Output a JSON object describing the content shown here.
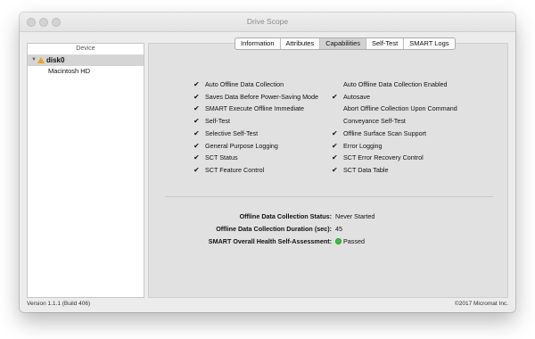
{
  "window": {
    "title": "Drive Scope"
  },
  "sidebar": {
    "header": "Device",
    "disk": {
      "label": "disk0",
      "icon": "warning-icon"
    },
    "volumes": [
      "Macintosh HD"
    ]
  },
  "tabs": [
    {
      "label": "Information",
      "active": false
    },
    {
      "label": "Attributes",
      "active": false
    },
    {
      "label": "Capabilities",
      "active": true
    },
    {
      "label": "Self-Test",
      "active": false
    },
    {
      "label": "SMART Logs",
      "active": false
    }
  ],
  "capabilities": {
    "left": [
      {
        "label": "Auto Offline Data Collection",
        "checked": true
      },
      {
        "label": "Saves Data Before Power-Saving Mode",
        "checked": true
      },
      {
        "label": "SMART Execute Offline Immediate",
        "checked": true
      },
      {
        "label": "Self-Test",
        "checked": true
      },
      {
        "label": "Selective Self-Test",
        "checked": true
      },
      {
        "label": "General Purpose Logging",
        "checked": true
      },
      {
        "label": "SCT Status",
        "checked": true
      },
      {
        "label": "SCT Feature Control",
        "checked": true
      }
    ],
    "right": [
      {
        "label": "Auto Offline Data Collection Enabled",
        "checked": false
      },
      {
        "label": "Autosave",
        "checked": true
      },
      {
        "label": "Abort Offline Collection Upon Command",
        "checked": false
      },
      {
        "label": "Conveyance Self-Test",
        "checked": false
      },
      {
        "label": "Offline Surface Scan Support",
        "checked": true
      },
      {
        "label": "Error Logging",
        "checked": true
      },
      {
        "label": "SCT Error Recovery Control",
        "checked": true
      },
      {
        "label": "SCT Data Table",
        "checked": true
      }
    ]
  },
  "status": {
    "offline_status_label": "Offline Data Collection Status:",
    "offline_status_value": "Never Started",
    "duration_label": "Offline Data Collection Duration (sec):",
    "duration_value": "45",
    "health_label": "SMART Overall Health Self-Assessment:",
    "health_value": "Passed",
    "health_color": "#3cc13c"
  },
  "footer": {
    "version": "Version 1.1.1 (Build 406)",
    "copyright": "©2017 Micromat Inc."
  }
}
